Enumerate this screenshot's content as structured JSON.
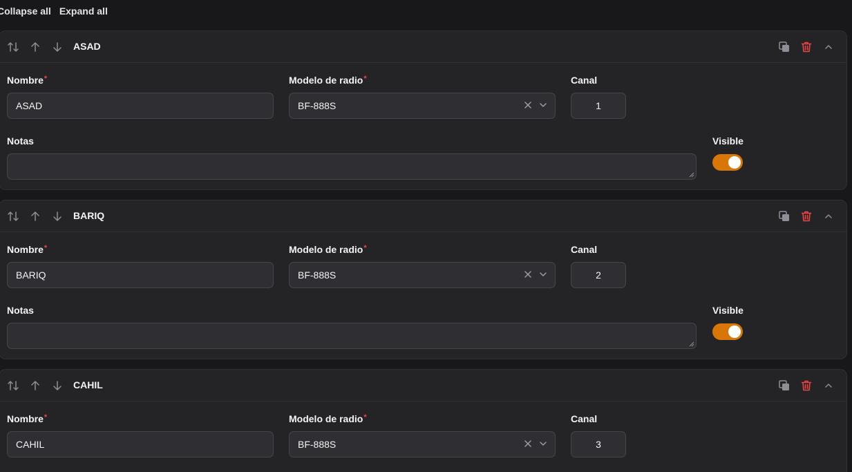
{
  "toolbar": {
    "collapse_all": "Collapse all",
    "expand_all": "Expand all"
  },
  "labels": {
    "nombre": "Nombre",
    "modelo": "Modelo de radio",
    "canal": "Canal",
    "notas": "Notas",
    "visible": "Visible",
    "required_mark": "*"
  },
  "icons": {
    "reorder": "reorder-icon",
    "move_up": "arrow-up-icon",
    "move_down": "arrow-down-icon",
    "clone": "clone-icon",
    "delete": "trash-icon",
    "collapse": "chevron-up-icon",
    "clear": "x-icon",
    "dropdown": "chevron-down-icon"
  },
  "colors": {
    "accent": "#d97706",
    "danger": "#ef4444",
    "background": "#18181b",
    "card": "#242427"
  },
  "items": [
    {
      "title": "ASAD",
      "nombre": "ASAD",
      "modelo": "BF-888S",
      "canal": "1",
      "notas": "",
      "visible": true
    },
    {
      "title": "BARIQ",
      "nombre": "BARIQ",
      "modelo": "BF-888S",
      "canal": "2",
      "notas": "",
      "visible": true
    },
    {
      "title": "CAHIL",
      "nombre": "CAHIL",
      "modelo": "BF-888S",
      "canal": "3",
      "notas": "",
      "visible": true
    }
  ]
}
